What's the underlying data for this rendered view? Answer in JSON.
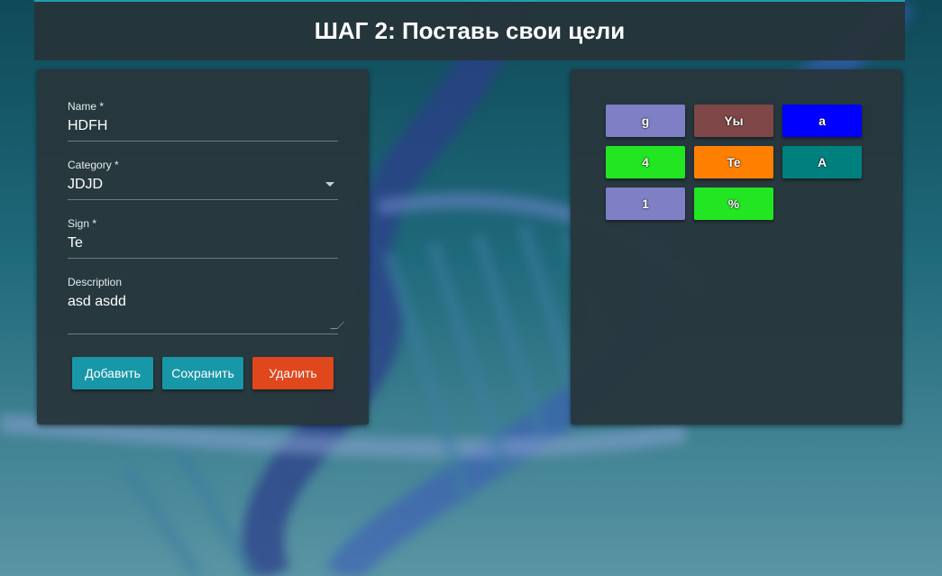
{
  "header": {
    "title": "ШАГ 2: Поставь свои цели"
  },
  "form": {
    "name": {
      "label": "Name *",
      "value": "HDFH"
    },
    "category": {
      "label": "Category *",
      "value": "JDJD"
    },
    "sign": {
      "label": "Sign *",
      "value": "Te"
    },
    "description": {
      "label": "Description",
      "value": "asd asdd"
    },
    "buttons": {
      "add": "Добавить",
      "save": "Сохранить",
      "delete": "Удалить"
    }
  },
  "goals": [
    {
      "label": "g",
      "color": "#7f7fc6"
    },
    {
      "label": "Yы",
      "color": "#7f4747"
    },
    {
      "label": "a",
      "color": "#0000ff"
    },
    {
      "label": "4",
      "color": "#22e622"
    },
    {
      "label": "Te",
      "color": "#ff8000"
    },
    {
      "label": "A",
      "color": "#007f7f"
    },
    {
      "label": "1",
      "color": "#7f7fc6"
    },
    {
      "label": "%",
      "color": "#22e622"
    }
  ]
}
